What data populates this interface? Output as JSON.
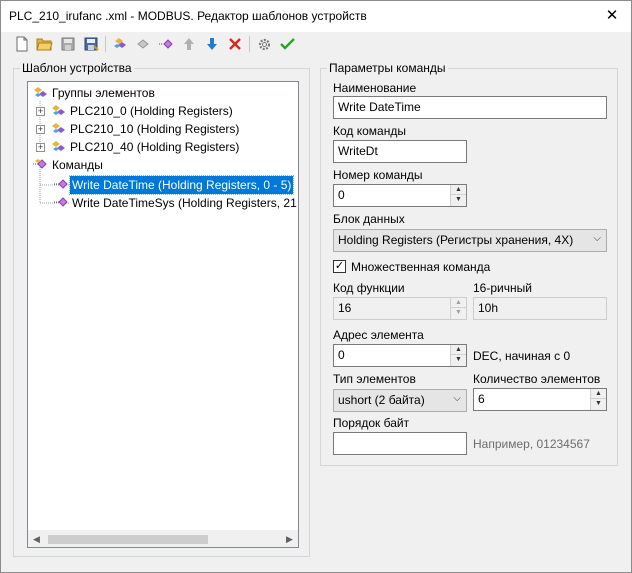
{
  "window": {
    "title": "PLC_210_irufanc .xml - MODBUS. Редактор шаблонов устройств",
    "close_glyph": "✕"
  },
  "toolbar": {
    "icons": [
      "new-file-icon",
      "open-folder-icon",
      "save-icon",
      "save-as-icon",
      "add-group-icon",
      "add-element-icon",
      "add-command-icon",
      "move-up-icon",
      "move-down-icon",
      "delete-icon",
      "settings-icon",
      "apply-icon"
    ],
    "colors": {
      "folder": "#e3b23c",
      "save": "#4c6b9e",
      "up": "#b0b0b0",
      "down": "#1e7bd6",
      "delete": "#d9291c",
      "apply": "#2ba32b"
    }
  },
  "template_panel": {
    "title": "Шаблон устройства",
    "tree": {
      "groups_label": "Группы элементов",
      "groups": [
        "PLC210_0 (Holding Registers)",
        "PLC210_10 (Holding Registers)",
        "PLC210_40 (Holding Registers)"
      ],
      "commands_label": "Команды",
      "commands": [
        "Write DateTime (Holding Registers, 0 - 5)",
        "Write DateTimeSys (Holding Registers, 21 - "
      ],
      "selected_index": 0
    }
  },
  "params_panel": {
    "title": "Параметры команды",
    "name_label": "Наименование",
    "name_value": "Write DateTime",
    "code_label": "Код команды",
    "code_value": "WriteDt",
    "number_label": "Номер команды",
    "number_value": "0",
    "block_label": "Блок данных",
    "block_value": "Holding Registers (Регистры хранения, 4X)",
    "multi_label": "Множественная команда",
    "multi_checked": true,
    "func_label": "Код функции",
    "func_value": "16",
    "hex_label": "16-ричный",
    "hex_value": "10h",
    "address_label": "Адрес элемента",
    "address_value": "0",
    "address_hint": "DEC, начиная с 0",
    "type_label": "Тип элементов",
    "type_value": "ushort (2 байта)",
    "count_label": "Количество элементов",
    "count_value": "6",
    "byteorder_label": "Порядок байт",
    "byteorder_value": "",
    "byteorder_hint": "Например, 01234567"
  }
}
